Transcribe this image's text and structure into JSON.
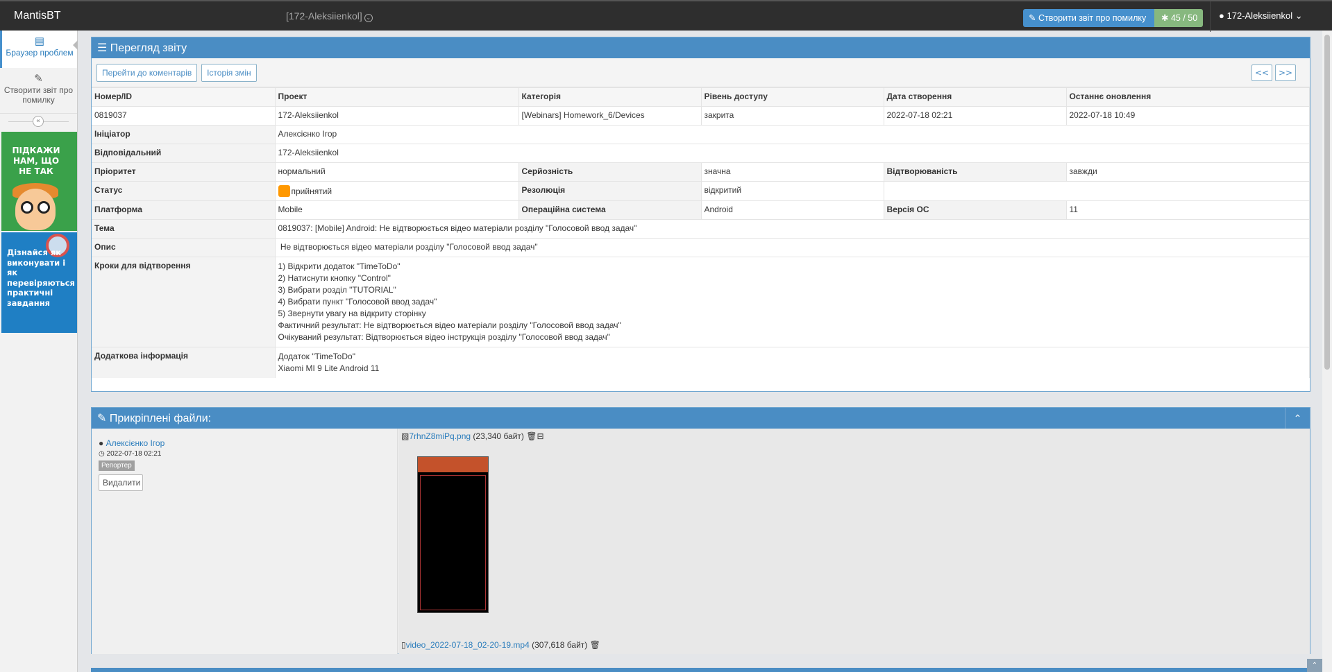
{
  "navbar": {
    "brand": "MantisBT",
    "project": "[172-Aleksiienkol]",
    "report_button": "Створити звіт про помилку",
    "count_button": "45 / 50",
    "user": "172-Aleksiienkol"
  },
  "sidebar": {
    "items": [
      {
        "label": "Браузер проблем",
        "icon": "list-icon"
      },
      {
        "label": "Створити звіт про помилку",
        "icon": "edit-icon"
      }
    ],
    "ad1_text": "ПІДКАЖИ НАМ, ЩО НЕ ТАК",
    "ad2_text": "Дізнайся як виконувати і як перевіряються практичні завдання"
  },
  "view": {
    "title": "Перегляд звіту",
    "btn_comments": "Перейти до коментарів",
    "btn_history": "Історія змін",
    "btn_prev": "<<",
    "btn_next": ">>",
    "headers": [
      "Номер/ID",
      "Проект",
      "Категорія",
      "Рівень доступу",
      "Дата створення",
      "Останнє оновлення"
    ],
    "values": [
      "0819037",
      "172-Aleksiienkol",
      "[Webinars] Homework_6/Devices",
      "закрита",
      "2022-07-18 02:21",
      "2022-07-18 10:49"
    ],
    "initiator_label": "Ініціатор",
    "initiator": "Алексієнко Ігор",
    "assigned_label": "Відповідальний",
    "assigned": "172-Aleksiienkol",
    "priority_label": "Пріоритет",
    "priority": "нормальний",
    "severity_label": "Серйозність",
    "severity": "значна",
    "reproducibility_label": "Відтворюваність",
    "reproducibility": "завжди",
    "status_label": "Статус",
    "status": "прийнятий",
    "status_color": "#ff9800",
    "resolution_label": "Резолюція",
    "resolution": "відкритий",
    "platform_label": "Платформа",
    "platform": "Mobile",
    "os_label": "Операційна система",
    "os": "Android",
    "os_version_label": "Версія ОС",
    "os_version": "11",
    "summary_label": "Тема",
    "summary": "0819037: [Mobile] Android: Не відтворюється відео матеріали розділу \"Голосовой ввод задач\"",
    "description_label": "Опис",
    "description": " Не відтворюється відео матеріали розділу \"Голосовой ввод задач\"",
    "steps_label": "Кроки для відтворення",
    "steps": [
      "1) Відкрити додаток \"TimeToDo\"",
      "2) Натиснути кнопку \"Control\"",
      "3) Вибрати розділ \"TUTORIAL\"",
      "4) Вибрати пункт \"Голосовой ввод задач\"",
      "5) Звернути увагу на відкриту сторінку",
      "Фактичний результат: Не відтворюється відео матеріали розділу \"Голосовой ввод задач\"",
      "Очікуваний результат: Відтворюється відео інструкція розділу \"Голосовой ввод задач\""
    ],
    "additional_label": "Додаткова інформація",
    "additional": [
      "Додаток \"TimeToDo\"",
      "Xiaomi MI 9 Lite Android 11"
    ]
  },
  "attachments": {
    "title": "Прикріплені файли:",
    "author": "Алексієнко Ігор",
    "date": "2022-07-18 02:21",
    "role": "Репортер",
    "delete_button": "Видалити",
    "file1_name": "7rhnZ8miPq.png",
    "file1_size": "(23,340 байт)",
    "file2_name": "video_2022-07-18_02-20-19.mp4",
    "file2_size": "(307,618 байт)"
  }
}
